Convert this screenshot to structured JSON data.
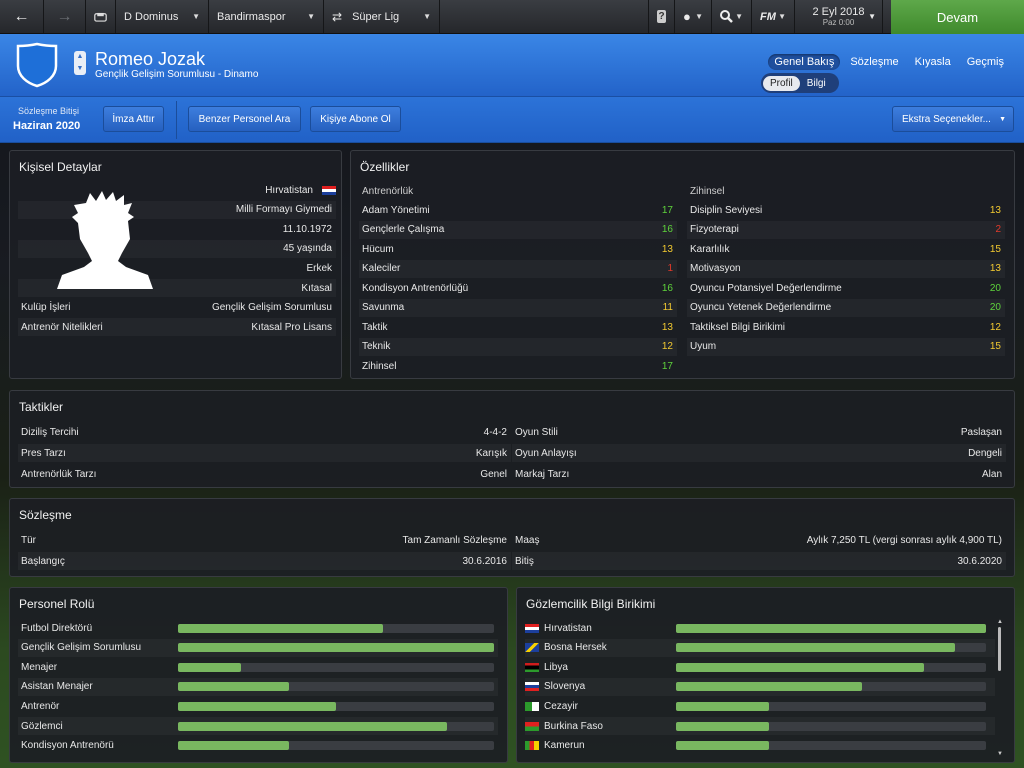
{
  "topbar": {
    "home_icon": "back-arrow-icon",
    "forward_icon": "forward-arrow-icon",
    "manager_name": "D Dominus",
    "club_name": "Bandirmaspor",
    "competition": "Süper Lig",
    "help_label": "?",
    "date": "2 Eyl 2018",
    "day_time": "Paz 0:00",
    "fm_label": "FM",
    "continue_label": "Devam"
  },
  "header": {
    "person_name": "Romeo Jozak",
    "person_role": "Gençlik Gelişim Sorumlusu - Dinamo",
    "tabs": [
      "Genel Bakış",
      "Sözleşme",
      "Kıyasla",
      "Geçmiş"
    ],
    "subtabs": [
      "Profil",
      "Bilgi"
    ]
  },
  "actionbar": {
    "contract_expiry_label": "Sözleşme Bitişi",
    "contract_expiry_value": "Haziran 2020",
    "sign_label": "İmza Attır",
    "similar_staff_label": "Benzer Personel Ara",
    "subscribe_label": "Kişiye Abone Ol",
    "extra_options_label": "Ekstra Seçenekler..."
  },
  "personal": {
    "title": "Kişisel Detaylar",
    "rows": [
      {
        "label": "",
        "value": "Hırvatistan"
      },
      {
        "label": "",
        "value": "Milli Formayı Giymedi"
      },
      {
        "label": "",
        "value": "11.10.1972"
      },
      {
        "label": "",
        "value": "45 yaşında"
      },
      {
        "label": "",
        "value": "Erkek"
      },
      {
        "label": "",
        "value": "Kıtasal"
      },
      {
        "label": "Kulüp İşleri",
        "value": "Gençlik Gelişim Sorumlusu"
      },
      {
        "label": "Antrenör Nitelikleri",
        "value": "Kıtasal Pro Lisans"
      }
    ]
  },
  "attributes": {
    "title": "Özellikler",
    "coaching_title": "Antrenörlük",
    "mental_title": "Zihinsel",
    "coaching": [
      {
        "label": "Adam Yönetimi",
        "value": "17",
        "color": "#5ed23b"
      },
      {
        "label": "Gençlerle Çalışma",
        "value": "16",
        "color": "#5ed23b"
      },
      {
        "label": "Hücum",
        "value": "13",
        "color": "#f2c930"
      },
      {
        "label": "Kaleciler",
        "value": "1",
        "color": "#e23a2a"
      },
      {
        "label": "Kondisyon Antrenörlüğü",
        "value": "16",
        "color": "#5ed23b"
      },
      {
        "label": "Savunma",
        "value": "11",
        "color": "#f2c930"
      },
      {
        "label": "Taktik",
        "value": "13",
        "color": "#f2c930"
      },
      {
        "label": "Teknik",
        "value": "12",
        "color": "#f2c930"
      },
      {
        "label": "Zihinsel",
        "value": "17",
        "color": "#5ed23b"
      }
    ],
    "mental": [
      {
        "label": "Disiplin Seviyesi",
        "value": "13",
        "color": "#f2c930"
      },
      {
        "label": "Fizyoterapi",
        "value": "2",
        "color": "#e23a2a"
      },
      {
        "label": "Kararlılık",
        "value": "15",
        "color": "#f2c930"
      },
      {
        "label": "Motivasyon",
        "value": "13",
        "color": "#f2c930"
      },
      {
        "label": "Oyuncu Potansiyel Değerlendirme",
        "value": "20",
        "color": "#5ed23b"
      },
      {
        "label": "Oyuncu Yetenek Değerlendirme",
        "value": "20",
        "color": "#5ed23b"
      },
      {
        "label": "Taktiksel Bilgi Birikimi",
        "value": "12",
        "color": "#f2c930"
      },
      {
        "label": "Uyum",
        "value": "15",
        "color": "#f2c930"
      }
    ]
  },
  "tactics": {
    "title": "Taktikler",
    "left": [
      {
        "label": "Diziliş Tercihi",
        "value": "4-4-2"
      },
      {
        "label": "Pres Tarzı",
        "value": "Karışık"
      },
      {
        "label": "Antrenörlük Tarzı",
        "value": "Genel"
      }
    ],
    "right": [
      {
        "label": "Oyun Stili",
        "value": "Paslaşan"
      },
      {
        "label": "Oyun Anlayışı",
        "value": "Dengeli"
      },
      {
        "label": "Markaj Tarzı",
        "value": "Alan"
      }
    ]
  },
  "contract": {
    "title": "Sözleşme",
    "left": [
      {
        "label": "Tür",
        "value": "Tam Zamanlı Sözleşme"
      },
      {
        "label": "Başlangıç",
        "value": "30.6.2016"
      }
    ],
    "right": [
      {
        "label": "Maaş",
        "value": "Aylık 7,250 TL (vergi sonrası aylık 4,900 TL)"
      },
      {
        "label": "Bitiş",
        "value": "30.6.2020"
      }
    ]
  },
  "roles": {
    "title": "Personel Rolü",
    "items": [
      {
        "label": "Futbol Direktörü",
        "level": 0.65
      },
      {
        "label": "Gençlik Gelişim Sorumlusu",
        "level": 1.0
      },
      {
        "label": "Menajer",
        "level": 0.2
      },
      {
        "label": "Asistan Menajer",
        "level": 0.35
      },
      {
        "label": "Antrenör",
        "level": 0.5
      },
      {
        "label": "Gözlemci",
        "level": 0.85
      },
      {
        "label": "Kondisyon Antrenörü",
        "level": 0.35
      }
    ]
  },
  "knowledge": {
    "title": "Gözlemcilik Bilgi Birikimi",
    "items": [
      {
        "country": "Hırvatistan",
        "flag": "croatia-flag-icon",
        "level": 1.0
      },
      {
        "country": "Bosna Hersek",
        "flag": "bosnia-flag-icon",
        "level": 0.9
      },
      {
        "country": "Libya",
        "flag": "libya-flag-icon",
        "level": 0.8
      },
      {
        "country": "Slovenya",
        "flag": "slovenia-flag-icon",
        "level": 0.6
      },
      {
        "country": "Cezayir",
        "flag": "algeria-flag-icon",
        "level": 0.3
      },
      {
        "country": "Burkina Faso",
        "flag": "burkina-faso-flag-icon",
        "level": 0.3
      },
      {
        "country": "Kamerun",
        "flag": "cameroon-flag-icon",
        "level": 0.3
      }
    ]
  }
}
